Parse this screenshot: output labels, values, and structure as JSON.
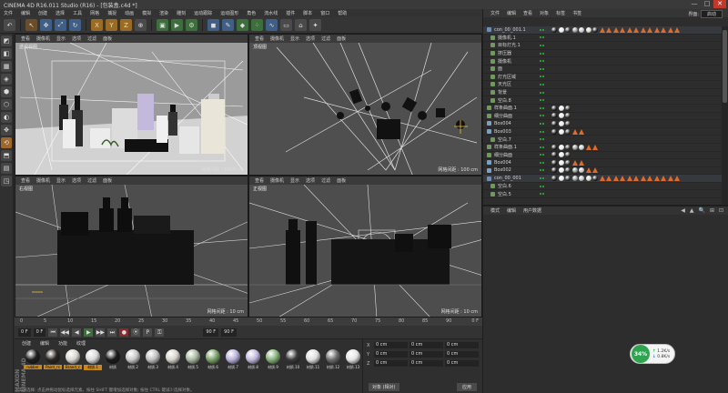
{
  "window": {
    "title": "CINEMA 4D R16.011 Studio (R16) - [包装盒.c4d *]",
    "buttons": [
      "—",
      "□",
      "✕"
    ]
  },
  "menubar": [
    "文件",
    "编辑",
    "创建",
    "选择",
    "工具",
    "网格",
    "捕捉",
    "动画",
    "模拟",
    "渲染",
    "雕刻",
    "运动跟踪",
    "运动图形",
    "角色",
    "流水线",
    "插件",
    "脚本",
    "窗口",
    "帮助"
  ],
  "toolbar": {
    "icons": [
      "undo-icon",
      "select-icon",
      "move-icon",
      "scale-icon",
      "rotate-icon",
      "x-axis-icon",
      "y-axis-icon",
      "z-axis-icon",
      "world-icon",
      "render-view-icon",
      "render-picture-icon",
      "render-settings-icon",
      "cube-icon",
      "pen-icon",
      "subdivision-icon",
      "array-icon",
      "deformer-icon",
      "floor-icon",
      "camera-icon",
      "light-icon"
    ],
    "icon_glyphs": [
      "↶",
      "↖",
      "✥",
      "⤢",
      "↻",
      "X",
      "Y",
      "Z",
      "⊕",
      "▣",
      "▶",
      "⚙",
      "◼",
      "✎",
      "◆",
      "⁘",
      "∿",
      "▭",
      "⌂",
      "✦"
    ]
  },
  "lefttools": [
    "◩",
    "◧",
    "▦",
    "◈",
    "⬢",
    "⬡",
    "◐",
    "✥",
    "⟲",
    "⬒",
    "▤",
    "◳"
  ],
  "viewports": [
    {
      "name": "透视视图",
      "grid": "网格间距 : 1000 cm",
      "menu": [
        "查看",
        "摄像机",
        "显示",
        "选项",
        "过滤",
        "面板"
      ]
    },
    {
      "name": "顶视图",
      "grid": "网格间距 : 100 cm",
      "menu": [
        "查看",
        "摄像机",
        "显示",
        "选项",
        "过滤",
        "面板"
      ]
    },
    {
      "name": "右视图",
      "grid": "网格间距 : 10 cm",
      "menu": [
        "查看",
        "摄像机",
        "显示",
        "选项",
        "过滤",
        "面板"
      ]
    },
    {
      "name": "正视图",
      "grid": "网格间距 : 10 cm",
      "menu": [
        "查看",
        "摄像机",
        "显示",
        "选项",
        "过滤",
        "面板"
      ]
    }
  ],
  "timeline": {
    "ruler_marks": [
      "0",
      "5",
      "10",
      "15",
      "20",
      "25",
      "30",
      "35",
      "40",
      "45",
      "50",
      "55",
      "60",
      "65",
      "70",
      "75",
      "80",
      "85",
      "90"
    ],
    "end_frame_label": "0 F",
    "start_field": "0 F",
    "current_field": "0 F",
    "end_field": "90 F",
    "end_field2": "90 F",
    "buttons": [
      "⏮",
      "◀◀",
      "◀",
      "▶",
      "▶▶",
      "⏭",
      "●",
      "⦿",
      "P",
      "⚿"
    ]
  },
  "materials": {
    "menu": [
      "创建",
      "编辑",
      "功能",
      "纹理"
    ],
    "items": [
      {
        "label": "rubber",
        "color": "#1d1d1d",
        "selected": true
      },
      {
        "label": "Paint_rs",
        "color": "#2a2620",
        "selected": true
      },
      {
        "label": "Brand_c",
        "color": "#d9d6cf",
        "selected": true
      },
      {
        "label": "材质.1",
        "color": "#d8d8d8",
        "selected": true
      },
      {
        "label": "材质",
        "color": "#1a1a1a",
        "selected": false
      },
      {
        "label": "材质.2",
        "color": "#c8c8c8",
        "selected": false
      },
      {
        "label": "材质.3",
        "color": "#bfbfbf",
        "selected": false
      },
      {
        "label": "材质.4",
        "color": "#d6d3ca",
        "selected": false
      },
      {
        "label": "材质.5",
        "color": "#a7b8a0",
        "selected": false
      },
      {
        "label": "材质.6",
        "color": "#7aa36a",
        "selected": false
      },
      {
        "label": "材质.7",
        "color": "#b7b1d8",
        "selected": false
      },
      {
        "label": "材质.8",
        "color": "#c2b9dd",
        "selected": false
      },
      {
        "label": "材质.9",
        "color": "#86b079",
        "selected": false
      },
      {
        "label": "材质.10",
        "color": "#3a3a3a",
        "selected": false
      },
      {
        "label": "材质.11",
        "color": "#dedede",
        "selected": false
      },
      {
        "label": "材质.12",
        "color": "#6d6d6d",
        "selected": false
      },
      {
        "label": "材质.13",
        "color": "#e4e4e4",
        "selected": false
      },
      {
        "label": "材质.14",
        "color": "#9c9c9c",
        "selected": false
      }
    ],
    "brand": "MAXON CINEMA 4D"
  },
  "coords": {
    "labels": [
      "X",
      "Y",
      "Z"
    ],
    "values": [
      "0 cm",
      "0 cm",
      "0 cm"
    ],
    "mode": "对象 (相对)",
    "apply": "应用"
  },
  "objects": {
    "menu": [
      "文件",
      "编辑",
      "查看",
      "对象",
      "标签",
      "书签"
    ],
    "layout_label": "界面:",
    "layout_value": "启动",
    "rows": [
      {
        "name": "con_00_001.1",
        "tags": "full"
      },
      {
        "name": "摄像机.1",
        "tags": "none"
      },
      {
        "name": "目标灯光.1",
        "tags": "none"
      },
      {
        "name": "挤压器",
        "tags": "none"
      },
      {
        "name": "摄像机",
        "tags": "none"
      },
      {
        "name": "面",
        "tags": "none"
      },
      {
        "name": "灯光区域",
        "tags": "none"
      },
      {
        "name": "天光区",
        "tags": "none"
      },
      {
        "name": "背景",
        "tags": "none"
      },
      {
        "name": "空白.8",
        "tags": "none"
      },
      {
        "name": "样条曲面.1",
        "tags": "small"
      },
      {
        "name": "细分曲面",
        "tags": "small"
      },
      {
        "name": "Box004",
        "tags": "small"
      },
      {
        "name": "Box003",
        "tags": "tri"
      },
      {
        "name": "空白.7",
        "tags": "none"
      },
      {
        "name": "样条曲面.1",
        "tags": "mid"
      },
      {
        "name": "细分曲面",
        "tags": "small"
      },
      {
        "name": "Box004",
        "tags": "tri"
      },
      {
        "name": "Box002",
        "tags": "mid"
      },
      {
        "name": "con_00_001",
        "tags": "full"
      },
      {
        "name": "空白.6",
        "tags": "none"
      },
      {
        "name": "空白.5",
        "tags": "none"
      }
    ]
  },
  "attributes": {
    "menu": [
      "模式",
      "编辑",
      "用户数据"
    ],
    "tools": [
      "◀",
      "▲",
      "🔍",
      "⊞",
      "⊡"
    ]
  },
  "network": {
    "percent": "34%",
    "up": "1.2K/s",
    "down": "0.8K/s"
  },
  "statusbar": "实时选择: 点击并拖动鼠标选择元素。按住 SHIFT 键增加选择对象; 按住 CTRL 键减少选择对象。"
}
